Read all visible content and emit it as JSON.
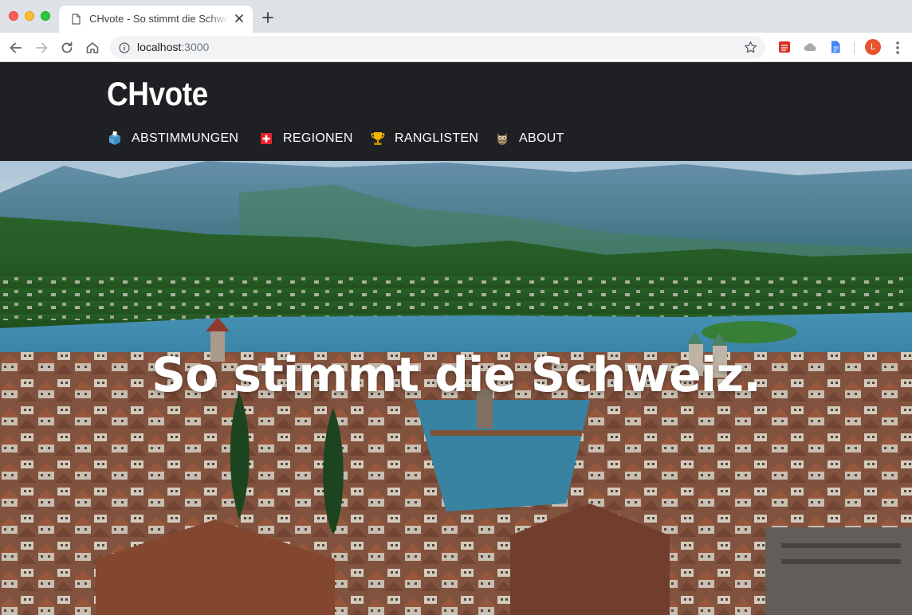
{
  "browser": {
    "tab_title": "CHvote - So stimmt die Schweiz.",
    "url_host": "localhost",
    "url_port": ":3000",
    "avatar_letter": "L",
    "icons": [
      "back-icon",
      "forward-icon",
      "reload-icon",
      "home-icon",
      "info-icon",
      "star-icon",
      "menu-icon"
    ]
  },
  "site": {
    "brand": "CHvote",
    "nav": [
      {
        "label": "ABSTIMMUNGEN",
        "icon": "ballot-box-icon"
      },
      {
        "label": "REGIONEN",
        "icon": "swiss-flag-icon"
      },
      {
        "label": "RANGLISTEN",
        "icon": "trophy-icon"
      },
      {
        "label": "ABOUT",
        "icon": "owl-icon"
      }
    ]
  },
  "hero": {
    "title": "So stimmt die Schweiz."
  },
  "colors": {
    "header_bg": "#1e2024",
    "tabstrip_bg": "#dee1e6",
    "accent_red": "#e8532d"
  }
}
